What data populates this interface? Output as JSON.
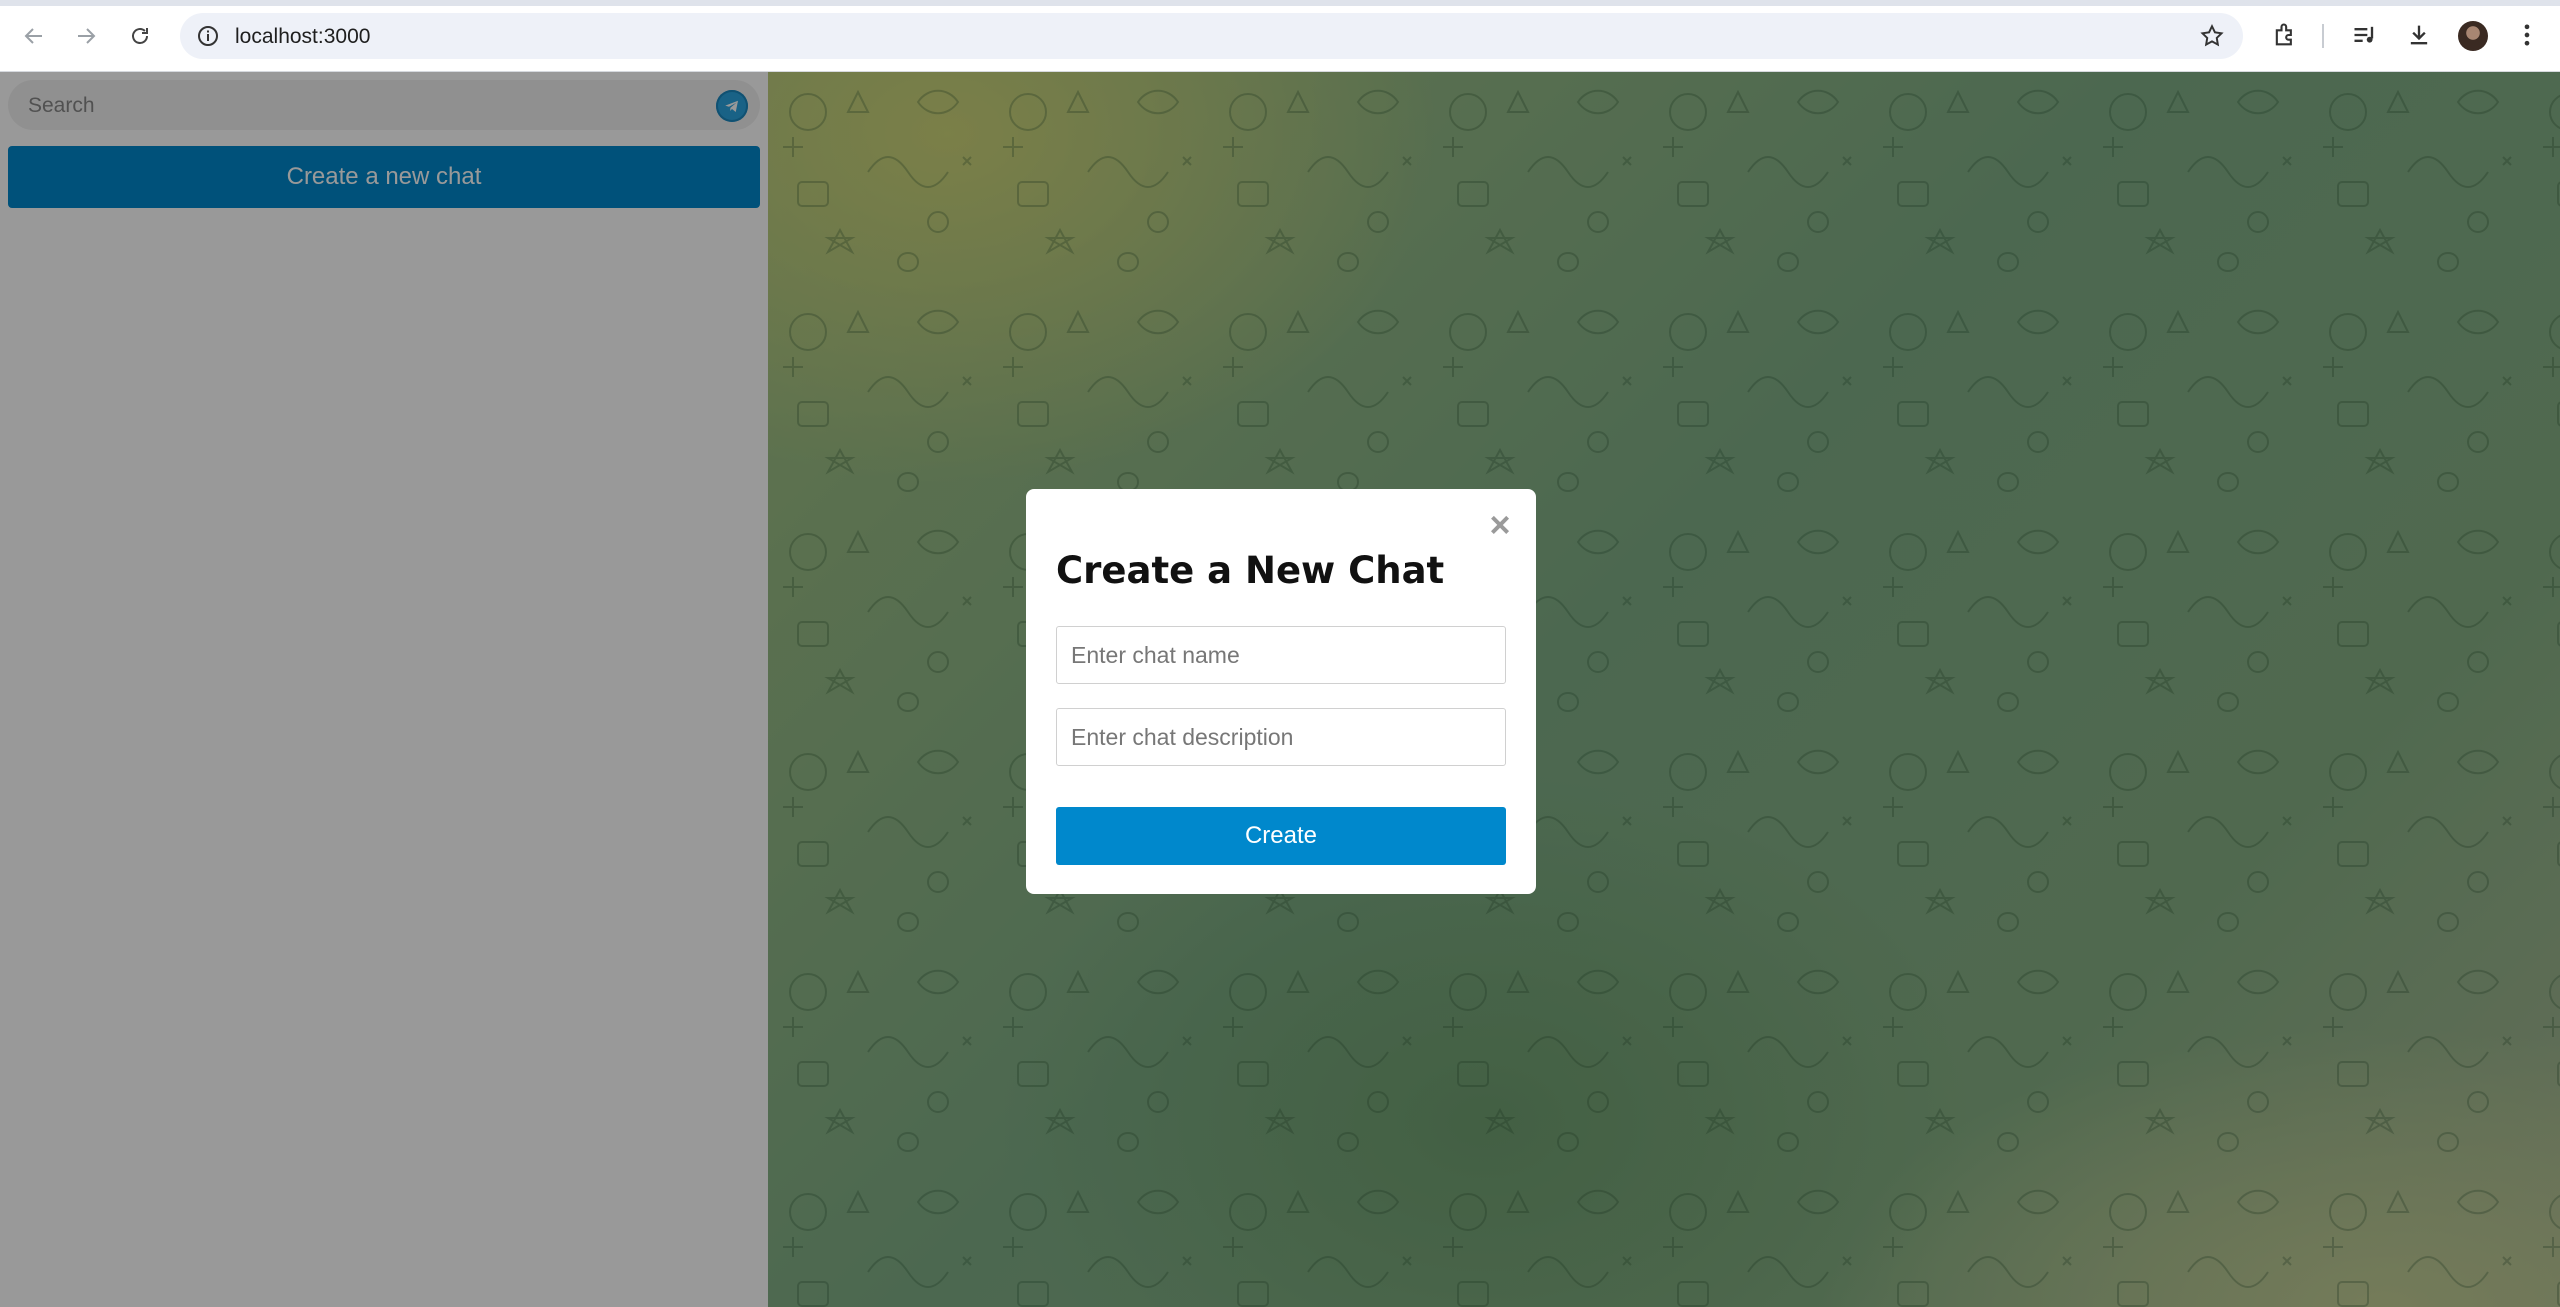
{
  "browser": {
    "url": "localhost:3000",
    "icons": [
      "back-icon",
      "forward-icon",
      "reload-icon",
      "site-info-icon",
      "bookmark-star-icon",
      "extensions-icon",
      "media-controls-icon",
      "download-icon",
      "profile-avatar",
      "more-menu-icon"
    ]
  },
  "sidebar": {
    "search_placeholder": "Search",
    "new_chat_button": "Create a new chat"
  },
  "modal": {
    "close_symbol": "×",
    "title": "Create a New Chat",
    "name_placeholder": "Enter chat name",
    "description_placeholder": "Enter chat description",
    "create_button": "Create"
  },
  "colors": {
    "accent": "#0088cc",
    "overlay": "rgba(0,0,0,0.4)"
  }
}
